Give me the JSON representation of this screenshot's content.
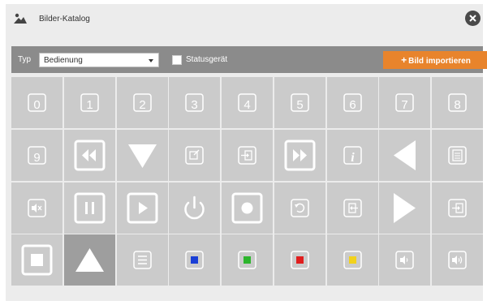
{
  "window": {
    "title": "Bilder-Katalog",
    "title_icon": "image-icon",
    "close_icon": "close-icon"
  },
  "toolbar": {
    "type_label": "Typ",
    "type_select": {
      "value": "Bedienung"
    },
    "status_checkbox": {
      "label": "Statusgerät",
      "checked": false
    },
    "import_button": {
      "plus": "+",
      "label": "Bild importieren",
      "color": "#e8842c"
    }
  },
  "catalog": {
    "selected_index": 28,
    "items": [
      {
        "icon": "digit-0",
        "text": "0"
      },
      {
        "icon": "digit-1",
        "text": "1"
      },
      {
        "icon": "digit-2",
        "text": "2"
      },
      {
        "icon": "digit-3",
        "text": "3"
      },
      {
        "icon": "digit-4",
        "text": "4"
      },
      {
        "icon": "digit-5",
        "text": "5"
      },
      {
        "icon": "digit-6",
        "text": "6"
      },
      {
        "icon": "digit-7",
        "text": "7"
      },
      {
        "icon": "digit-8",
        "text": "8"
      },
      {
        "icon": "digit-9",
        "text": "9"
      },
      {
        "icon": "rewind"
      },
      {
        "icon": "triangle-down"
      },
      {
        "icon": "input-switch"
      },
      {
        "icon": "input-arrow"
      },
      {
        "icon": "fast-forward"
      },
      {
        "icon": "info",
        "text": "i"
      },
      {
        "icon": "triangle-left"
      },
      {
        "icon": "document"
      },
      {
        "icon": "mute"
      },
      {
        "icon": "pause"
      },
      {
        "icon": "play"
      },
      {
        "icon": "power"
      },
      {
        "icon": "record"
      },
      {
        "icon": "undo"
      },
      {
        "icon": "input-left"
      },
      {
        "icon": "triangle-right"
      },
      {
        "icon": "enter-input"
      },
      {
        "icon": "stop"
      },
      {
        "icon": "triangle-up"
      },
      {
        "icon": "menu"
      },
      {
        "icon": "color-key-blue",
        "color": "#1a3fd6"
      },
      {
        "icon": "color-key-green",
        "color": "#2db52d"
      },
      {
        "icon": "color-key-red",
        "color": "#e01e1e"
      },
      {
        "icon": "color-key-yellow",
        "color": "#f2d21b"
      },
      {
        "icon": "volume-down"
      },
      {
        "icon": "volume-up"
      }
    ]
  }
}
